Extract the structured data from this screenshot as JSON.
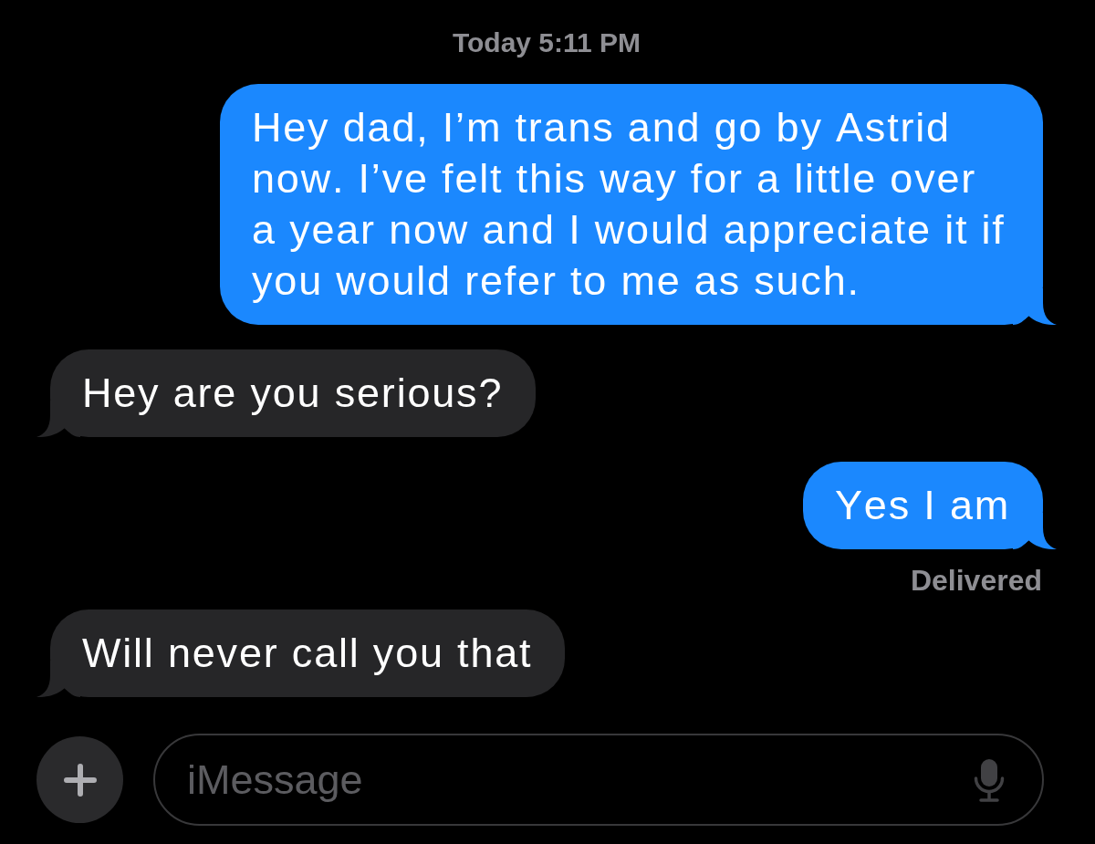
{
  "header": {
    "timestamp": "Today 5:11 PM"
  },
  "messages": [
    {
      "kind": "outgoing",
      "text": "Hey dad, I’m trans and go by Astrid now. I’ve felt this way for a little over a year now and I would appreciate it if you would refer to me as such."
    },
    {
      "kind": "incoming",
      "text": "Hey are you serious?"
    },
    {
      "kind": "outgoing",
      "text": "Yes I am",
      "status": "Delivered"
    },
    {
      "kind": "incoming",
      "text": "Will never call you that"
    }
  ],
  "composer": {
    "placeholder": "iMessage"
  }
}
